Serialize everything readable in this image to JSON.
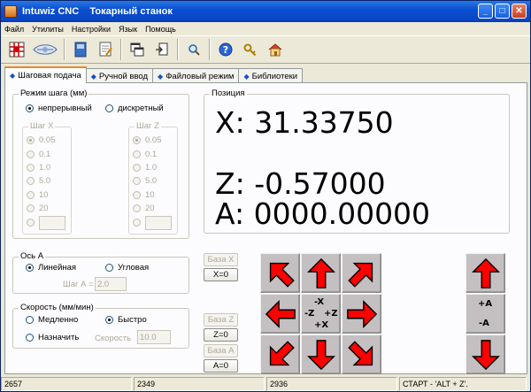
{
  "window": {
    "title": "Intuwiz CNC    Токарный станок",
    "minimize": "_",
    "maximize": "□",
    "close": "✕"
  },
  "menu": [
    "Файл",
    "Утилиты",
    "Настройки",
    "Язык",
    "Помощь"
  ],
  "toolbar": {
    "icons": [
      "grid-icon",
      "lathe-icon",
      "book-icon",
      "document-edit-icon",
      "windows-icon",
      "export-icon",
      "zoom-icon",
      "help-icon",
      "key-icon",
      "home-icon"
    ]
  },
  "tabs": [
    "Шаговая подача",
    "Ручной ввод",
    "Файловый режим",
    "Библиотеки"
  ],
  "step_mode": {
    "title": "Режим шага (мм)",
    "continuous": "непрерывный",
    "discrete": "дискретный",
    "step_x": {
      "title": "Шаг X",
      "options": [
        "0.05",
        "0.1",
        "1.0",
        "5.0",
        "10",
        "20"
      ]
    },
    "step_z": {
      "title": "Шаг Z",
      "options": [
        "0.05",
        "0.1",
        "1.0",
        "5.0",
        "10",
        "20"
      ]
    }
  },
  "position": {
    "title": "Позиция",
    "x": "X: 31.33750",
    "z": "Z: -0.57000",
    "a": "A: 0000.00000"
  },
  "axis_a": {
    "title": "Ось А",
    "linear": "Линейная",
    "angular": "Угловая",
    "step_label": "Шаг А =",
    "step_value": "2.0"
  },
  "speed": {
    "title": "Скорость (мм/мин)",
    "slow": "Медленно",
    "fast": "Быстро",
    "assign": "Назначить",
    "speed_label": "Скорость",
    "speed_value": "10.0"
  },
  "buttons": {
    "base_x": "База X",
    "x_zero": "X=0",
    "base_z": "База Z",
    "z_zero": "Z=0",
    "base_a": "База А",
    "a_zero": "A=0"
  },
  "jog": {
    "minus_x": "-X",
    "plus_x": "+X",
    "minus_z": "-Z",
    "plus_z": "+Z",
    "plus_a": "+A",
    "minus_a": "-A"
  },
  "status": [
    "2657",
    "2349",
    "2936",
    "СТАРТ - 'ALT + Z'."
  ],
  "colors": {
    "arrow": "#ff0000",
    "jog_bg": "#c4c0c2",
    "title_bar": "#0a4fd1"
  }
}
